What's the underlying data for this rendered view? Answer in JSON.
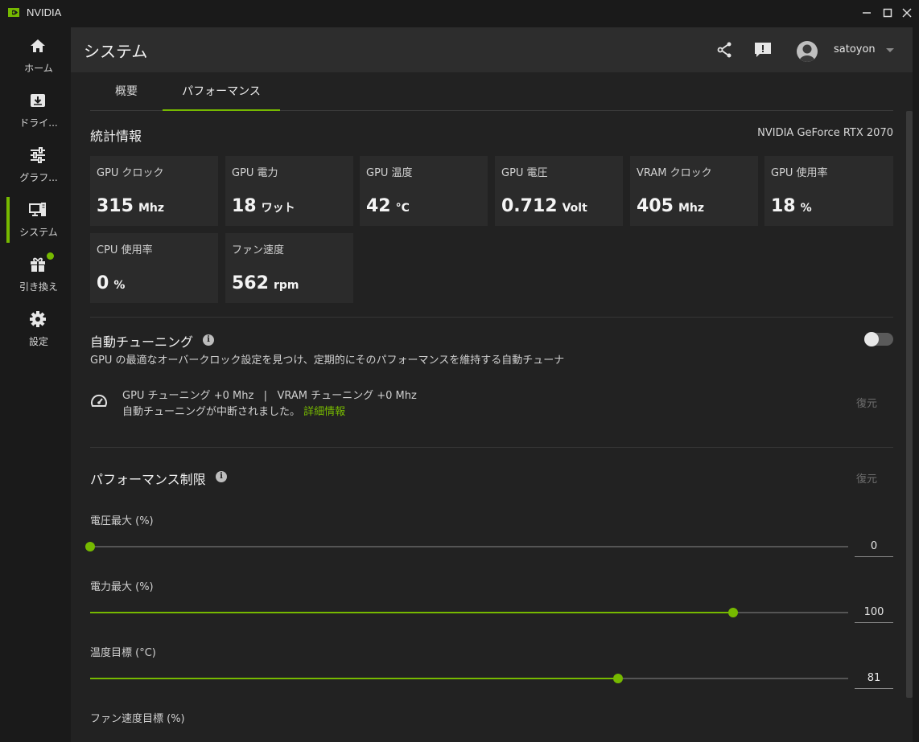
{
  "window": {
    "title": "NVIDIA"
  },
  "sidebar": {
    "items": [
      {
        "label": "ホーム",
        "icon": "home-icon"
      },
      {
        "label": "ドライ...",
        "icon": "driver-download-icon"
      },
      {
        "label": "グラフ...",
        "icon": "graphics-sliders-icon"
      },
      {
        "label": "システム",
        "icon": "system-monitor-icon",
        "active": true
      },
      {
        "label": "引き換え",
        "icon": "gift-icon",
        "badge": true
      },
      {
        "label": "設定",
        "icon": "gear-icon"
      }
    ]
  },
  "header": {
    "title": "システム",
    "username": "satoyon",
    "icons": [
      "share-icon",
      "feedback-icon",
      "avatar",
      "chevron-down-icon"
    ]
  },
  "tabs": [
    {
      "label": "概要",
      "active": false
    },
    {
      "label": "パフォーマンス",
      "active": true
    }
  ],
  "stats": {
    "title": "統計情報",
    "gpu_name": "NVIDIA GeForce RTX 2070",
    "cards": [
      {
        "label": "GPU クロック",
        "value": "315",
        "unit": "Mhz"
      },
      {
        "label": "GPU 電力",
        "value": "18",
        "unit": "ワット"
      },
      {
        "label": "GPU 温度",
        "value": "42",
        "unit": "°C"
      },
      {
        "label": "GPU 電圧",
        "value": "0.712",
        "unit": "Volt"
      },
      {
        "label": "VRAM クロック",
        "value": "405",
        "unit": "Mhz"
      },
      {
        "label": "GPU 使用率",
        "value": "18",
        "unit": "%"
      },
      {
        "label": "CPU 使用率",
        "value": "0",
        "unit": "%"
      },
      {
        "label": "ファン速度",
        "value": "562",
        "unit": "rpm"
      }
    ]
  },
  "auto_tuning": {
    "title": "自動チューニング",
    "description": "GPU の最適なオーバークロック設定を見つけ、定期的にそのパフォーマンスを維持する自動チューナ",
    "enabled": false,
    "status_line1": "GPU チューニング +0 Mhz   |   VRAM チューニング +0 Mhz",
    "status_line2": "自動チューニングが中断されました。",
    "details_link": "詳細情報",
    "restore_label": "復元"
  },
  "performance_limits": {
    "title": "パフォーマンス制限",
    "restore_label": "復元",
    "sliders": [
      {
        "label": "電圧最大 (%)",
        "value": "0",
        "fraction": 0.0
      },
      {
        "label": "電力最大 (%)",
        "value": "100",
        "fraction": 0.848
      },
      {
        "label": "温度目標 (°C)",
        "value": "81",
        "fraction": 0.696
      }
    ],
    "next_label": "ファン速度目標 (%)"
  },
  "colors": {
    "accent": "#76b900",
    "background": "#1a1a1a",
    "panel": "#222222",
    "card": "#2b2b2b"
  }
}
